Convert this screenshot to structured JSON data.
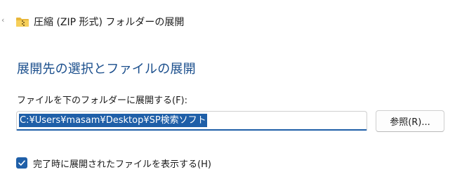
{
  "window": {
    "title": "圧縮 (ZIP 形式) フォルダーの展開",
    "back_icon": "chevron-left-icon",
    "folder_icon": "zip-folder-icon"
  },
  "main": {
    "heading": "展開先の選択とファイルの展開",
    "path_label": "ファイルを下のフォルダーに展開する(F):",
    "path_value": "C:¥Users¥masam¥Desktop¥SP検索ソフト",
    "browse_label": "参照(R)...",
    "show_files_label": "完了時に展開されたファイルを表示する(H)",
    "show_files_checked": true
  },
  "colors": {
    "accent": "#1f5fa8",
    "heading": "#1a4e8c",
    "folder": "#e8b73a"
  }
}
